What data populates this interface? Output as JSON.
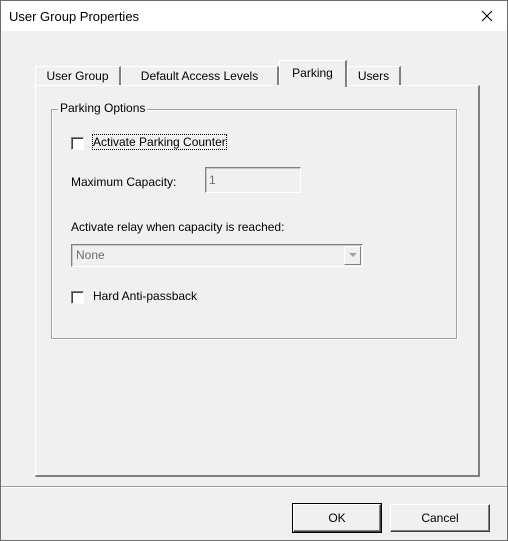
{
  "window": {
    "title": "User Group Properties",
    "close_icon": "close-icon"
  },
  "tabs": [
    {
      "label": "User Group",
      "active": false
    },
    {
      "label": "Default Access Levels",
      "active": false
    },
    {
      "label": "Parking",
      "active": true
    },
    {
      "label": "Users",
      "active": false
    }
  ],
  "parking": {
    "group_title": "Parking Options",
    "activate_counter": {
      "label": "Activate Parking Counter",
      "checked": false
    },
    "max_capacity": {
      "label": "Maximum Capacity:",
      "value": "1"
    },
    "relay": {
      "label": "Activate relay when capacity is reached:",
      "selected": "None"
    },
    "hard_antipassback": {
      "label": "Hard Anti-passback",
      "checked": false
    }
  },
  "buttons": {
    "ok": "OK",
    "cancel": "Cancel"
  }
}
